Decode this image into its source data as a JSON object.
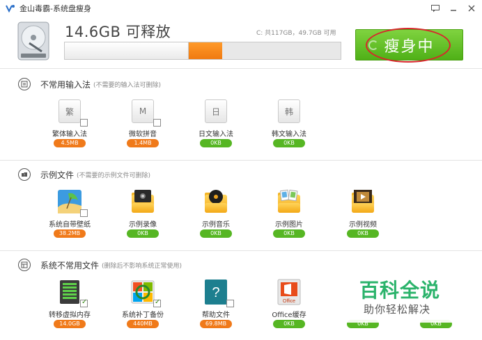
{
  "window": {
    "title": "金山毒霸-系统盘瘦身",
    "controls": [
      "chat-icon",
      "minimize-icon",
      "close-icon"
    ]
  },
  "header": {
    "free_title": "14.6GB 可释放",
    "disk_info": "C: 共117GB，49.7GB 可用",
    "slim_button": "瘦身中",
    "progress": {
      "used_fraction": 0.45,
      "releasable_fraction": 0.12
    }
  },
  "colors": {
    "orange": "#f07a1a",
    "green": "#56b623",
    "accent_red": "#d8262c"
  },
  "sections": [
    {
      "title": "不常用输入法",
      "note": "(不需要的输入法可删除)",
      "icon": "keyboard-icon",
      "items": [
        {
          "label": "繁体输入法",
          "size": "4.5MB",
          "glyph": "繁",
          "badge": "orange",
          "checked": false
        },
        {
          "label": "微软拼音",
          "size": "1.4MB",
          "glyph": "M",
          "badge": "orange",
          "checked": false
        },
        {
          "label": "日文输入法",
          "size": "0KB",
          "glyph": "日",
          "badge": "green",
          "checked": false
        },
        {
          "label": "韩文输入法",
          "size": "0KB",
          "glyph": "韩",
          "badge": "green",
          "checked": false
        }
      ]
    },
    {
      "title": "示例文件",
      "note": "(不需要的示例文件可删除)",
      "icon": "folder-icon",
      "items": [
        {
          "label": "系统自带壁纸",
          "size": "38.2MB",
          "icon": "wallpaper-icon",
          "badge": "orange",
          "checked": false
        },
        {
          "label": "示例录像",
          "size": "0KB",
          "icon": "video-folder-icon",
          "badge": "green"
        },
        {
          "label": "示例音乐",
          "size": "0KB",
          "icon": "music-folder-icon",
          "badge": "green"
        },
        {
          "label": "示例图片",
          "size": "0KB",
          "icon": "picture-folder-icon",
          "badge": "green"
        },
        {
          "label": "示例视频",
          "size": "0KB",
          "icon": "film-folder-icon",
          "badge": "green"
        }
      ]
    },
    {
      "title": "系统不常用文件",
      "note": "(删除后不影响系统正常使用)",
      "icon": "system-files-icon",
      "items": [
        {
          "label": "转移虚拟内存",
          "size": "14.0GB",
          "icon": "memory-icon",
          "badge": "orange",
          "checked": true
        },
        {
          "label": "系统补丁备份",
          "size": "440MB",
          "icon": "patch-icon",
          "badge": "orange",
          "checked": true
        },
        {
          "label": "帮助文件",
          "size": "69.8MB",
          "icon": "help-icon",
          "badge": "orange",
          "checked": false
        },
        {
          "label": "Office缓存",
          "size": "0KB",
          "icon": "office-icon",
          "badge": "green"
        },
        {
          "label": "",
          "size": "0KB",
          "icon": "",
          "badge": "green"
        },
        {
          "label": "",
          "size": "0KB",
          "icon": "",
          "badge": "green"
        }
      ]
    }
  ],
  "watermark": {
    "brand": "百科全说",
    "slogan": "助你轻松解决"
  }
}
